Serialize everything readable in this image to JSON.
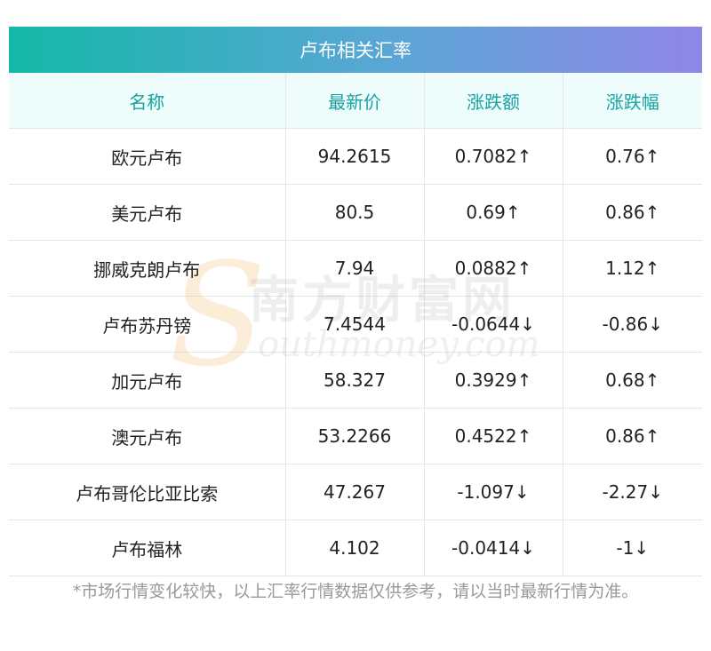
{
  "title": "卢布相关汇率",
  "columns": [
    "名称",
    "最新价",
    "涨跌额",
    "涨跌幅"
  ],
  "rows": [
    {
      "name": "欧元卢布",
      "price": "94.2615",
      "change": "0.7082↑",
      "pct": "0.76↑",
      "dir": "up"
    },
    {
      "name": "美元卢布",
      "price": "80.5",
      "change": "0.69↑",
      "pct": "0.86↑",
      "dir": "up"
    },
    {
      "name": "挪威克朗卢布",
      "price": "7.94",
      "change": "0.0882↑",
      "pct": "1.12↑",
      "dir": "up"
    },
    {
      "name": "卢布苏丹镑",
      "price": "7.4544",
      "change": "-0.0644↓",
      "pct": "-0.86↓",
      "dir": "down"
    },
    {
      "name": "加元卢布",
      "price": "58.327",
      "change": "0.3929↑",
      "pct": "0.68↑",
      "dir": "up"
    },
    {
      "name": "澳元卢布",
      "price": "53.2266",
      "change": "0.4522↑",
      "pct": "0.86↑",
      "dir": "up"
    },
    {
      "name": "卢布哥伦比亚比索",
      "price": "47.267",
      "change": "-1.097↓",
      "pct": "-2.27↓",
      "dir": "down"
    },
    {
      "name": "卢布福林",
      "price": "4.102",
      "change": "-0.0414↓",
      "pct": "-1↓",
      "dir": "down"
    }
  ],
  "watermark": {
    "letter": "S",
    "cn": "南方财富网",
    "en": "outhmoney.com"
  },
  "footnote": "*市场行情变化较快，以上汇率行情数据仅供参考，请以当时最新行情为准。",
  "colors": {
    "up": "#e8151b",
    "down": "#1f8a1f",
    "header_text": "#17a3a3",
    "header_bg": "#eefcfc",
    "banner_start": "#14b8a8",
    "banner_end": "#8f86e6"
  }
}
